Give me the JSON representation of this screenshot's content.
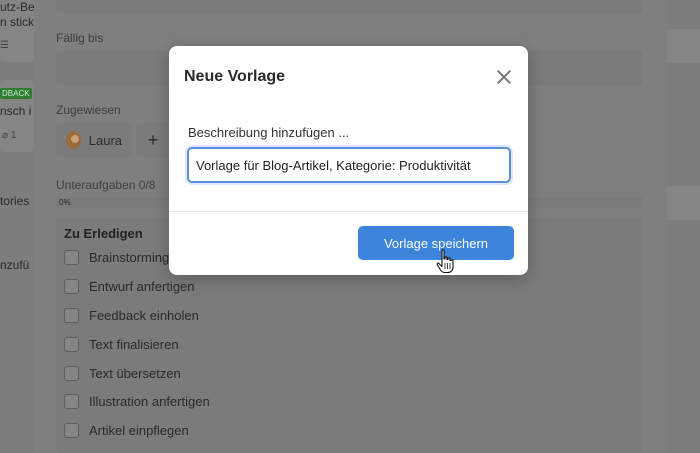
{
  "background": {
    "left_cards": {
      "card1_lines": [
        "utz-Be",
        "n stick"
      ],
      "badge": "DBACK",
      "card2_text": "nsch i",
      "meta": "1",
      "side_text_1": "tories",
      "side_text_2": "nzufü"
    },
    "panel": {
      "due_label": "Fällig bis",
      "assigned_label": "Zugewiesen",
      "assignee_name": "Laura",
      "add_assignee": "+",
      "subtasks_label": "Unteraufgaben 0/8",
      "progress_text": "0%",
      "progress_value": 0,
      "checklist_title": "Zu Erledigen",
      "checklist_items": [
        "Brainstorming",
        "Entwurf anfertigen",
        "Feedback einholen",
        "Text finalisieren",
        "Text übersetzen",
        "Illustration anfertigen",
        "Artikel einpflegen"
      ]
    }
  },
  "modal": {
    "title": "Neue Vorlage",
    "close_icon": "close-icon",
    "field_label": "Beschreibung hinzufügen ...",
    "input_value": "Vorlage für Blog-Artikel, Kategorie: Produktivität",
    "save_label": "Vorlage speichern",
    "accent_color": "#3d84dc"
  }
}
